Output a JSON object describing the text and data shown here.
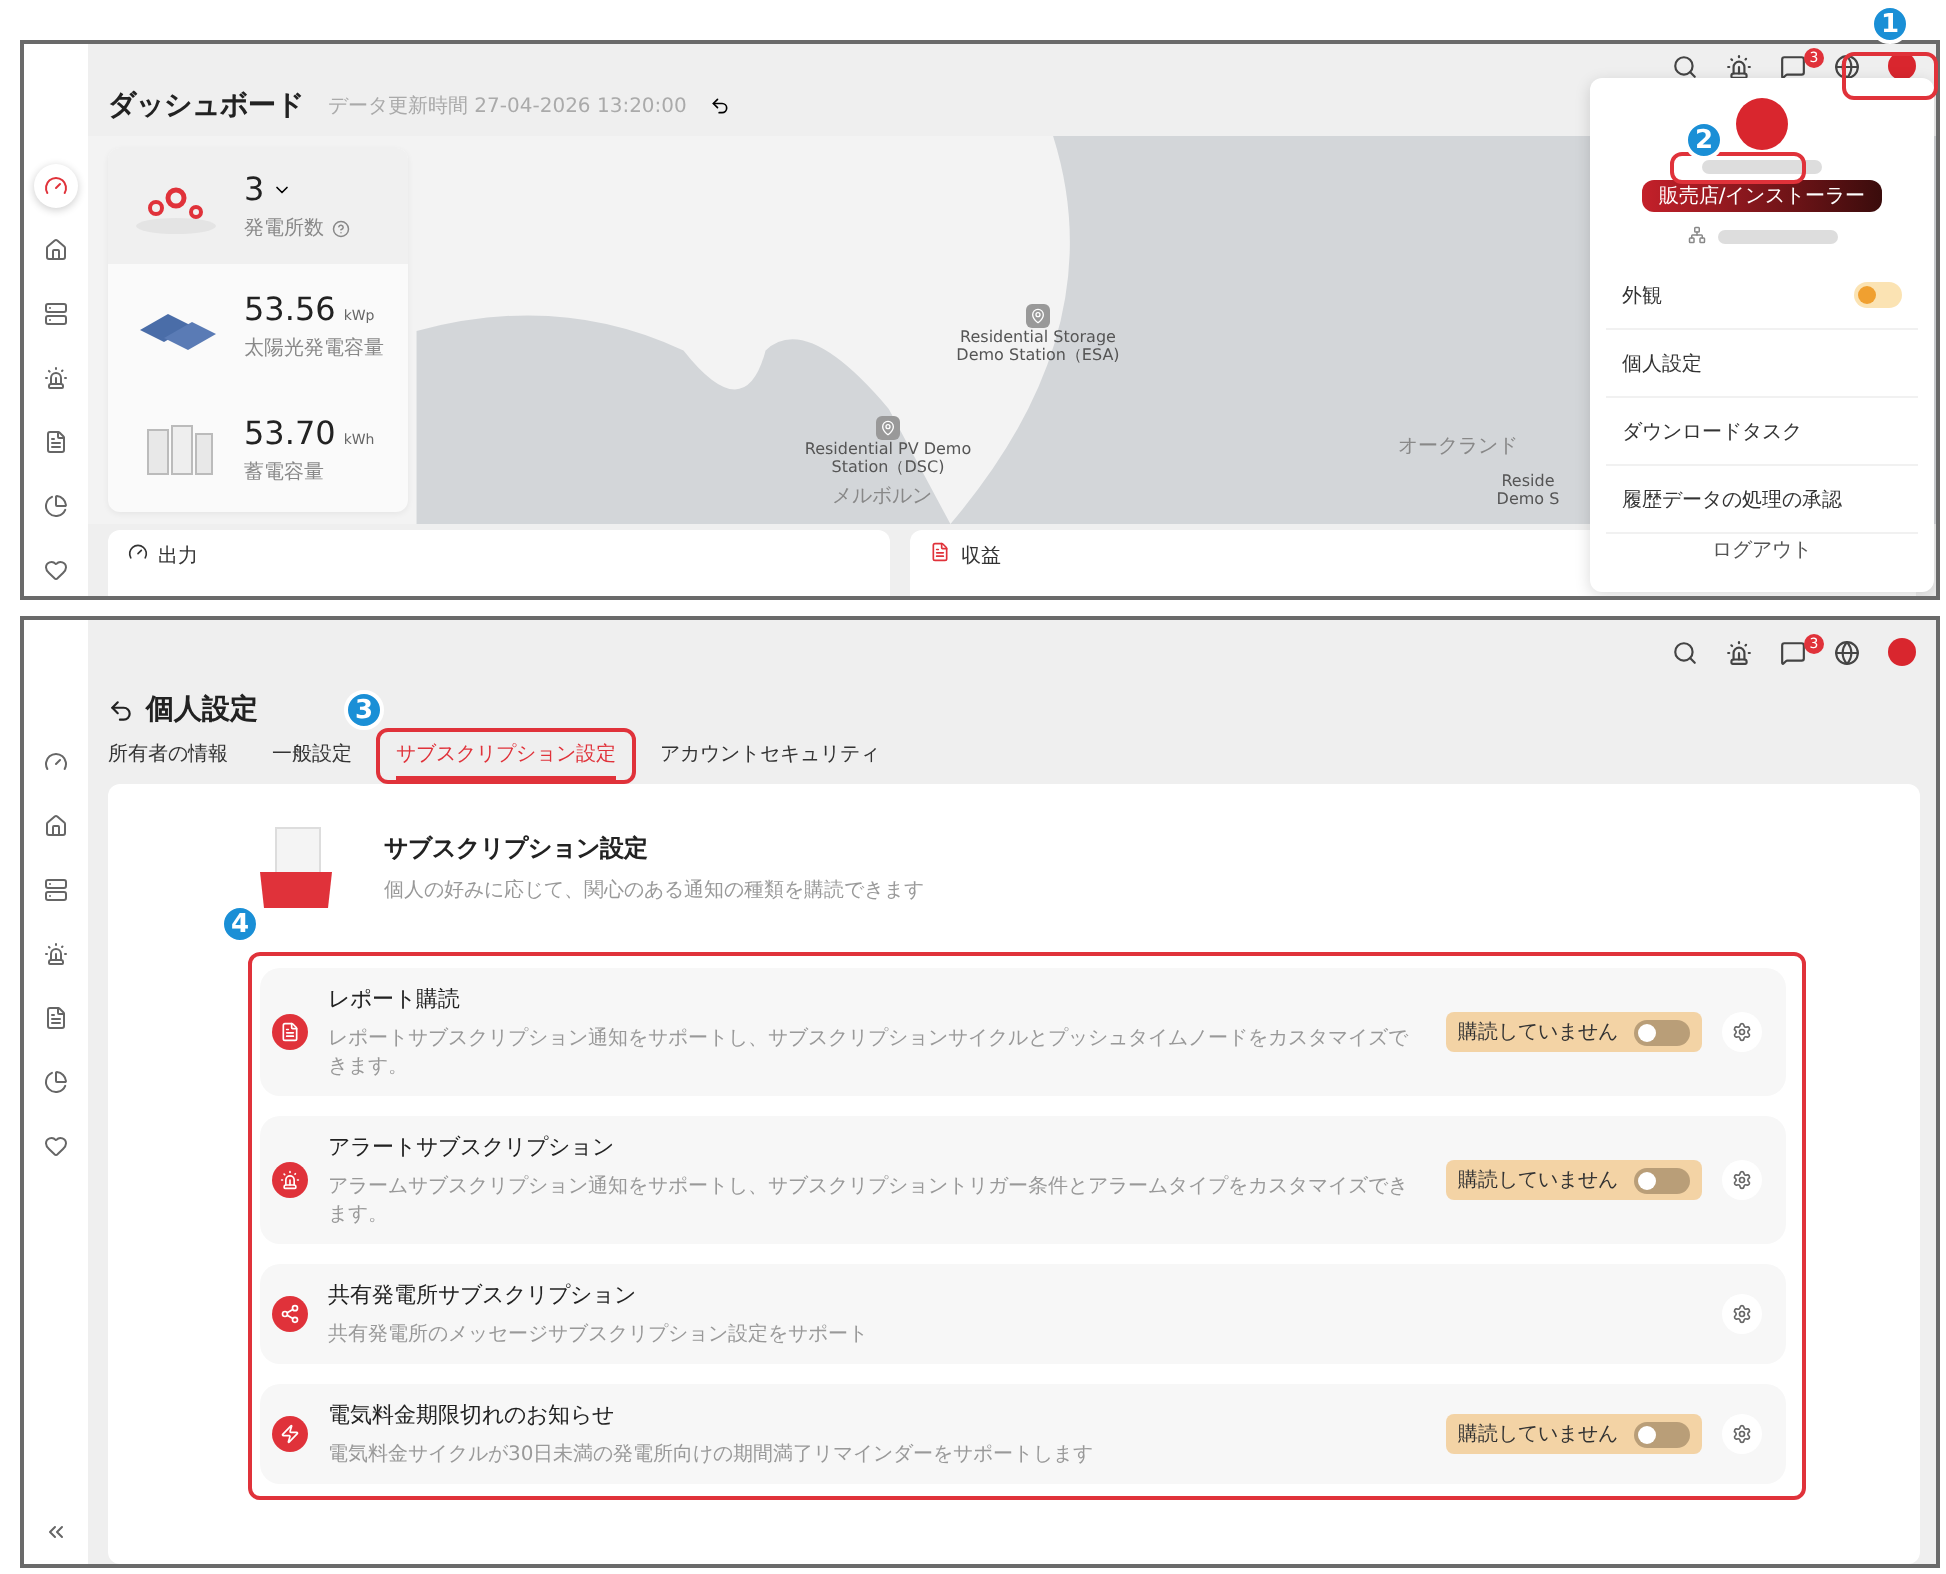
{
  "top_screen": {
    "sidebar_items": [
      {
        "selected": true
      },
      {
        "selected": false
      },
      {
        "selected": false
      },
      {
        "selected": false
      },
      {
        "selected": false
      },
      {
        "selected": false
      },
      {
        "selected": false
      }
    ],
    "message_badge": "3",
    "title": "ダッシュボード",
    "updated": "データ更新時間 27-04-2026 13:20:00",
    "stats": [
      {
        "kind": "count",
        "value": "3",
        "label": "発電所数"
      },
      {
        "kind": "solar",
        "value": "53.56",
        "unit": "kWp",
        "label": "太陽光発電容量"
      },
      {
        "kind": "storage",
        "value": "53.70",
        "unit": "kWh",
        "label": "蓄電容量"
      }
    ],
    "map_labels": [
      {
        "kind": "station",
        "text": "Residential Storage Demo Station（ESA)"
      },
      {
        "kind": "station",
        "text": "Residential PV Demo Station（DSC)"
      },
      {
        "kind": "city",
        "text": "メルボルン"
      },
      {
        "kind": "city",
        "text": "オークランド"
      },
      {
        "kind": "station",
        "text": "Reside Demo S"
      }
    ],
    "cards": [
      "出力",
      "収益"
    ],
    "user_menu": {
      "role": "販売店/インストーラー",
      "items": [
        {
          "kind": "toggle",
          "label": "外観",
          "on": false
        },
        {
          "kind": "link",
          "label": "個人設定"
        },
        {
          "kind": "link",
          "label": "ダウンロードタスク"
        },
        {
          "kind": "link",
          "label": "履歴データの処理の承認"
        }
      ],
      "logout": "ログアウト"
    }
  },
  "bottom_screen": {
    "message_badge": "3",
    "title": "個人設定",
    "tabs": [
      {
        "label": "所有者の情報",
        "selected": false
      },
      {
        "label": "一般設定",
        "selected": false
      },
      {
        "label": "サブスクリプション設定",
        "selected": true
      },
      {
        "label": "アカウントセキュリティ",
        "selected": false
      }
    ],
    "heading": "サブスクリプション設定",
    "subheading": "個人の好みに応じて、関心のある通知の種類を購読できます",
    "subscriptions": [
      {
        "kind": "report",
        "title": "レポート購読",
        "description": "レポートサブスクリプション通知をサポートし、サブスクリプションサイクルとプッシュタイムノードをカスタマイズできます。",
        "status": "購読していません",
        "on": false
      },
      {
        "kind": "alert",
        "title": "アラートサブスクリプション",
        "description": "アラームサブスクリプション通知をサポートし、サブスクリプショントリガー条件とアラームタイプをカスタマイズできます。",
        "status": "購読していません",
        "on": false
      },
      {
        "kind": "share",
        "title": "共有発電所サブスクリプション",
        "description": "共有発電所のメッセージサブスクリプション設定をサポート"
      },
      {
        "kind": "power",
        "title": "電気料金期限切れのお知らせ",
        "description": "電気料金サイクルが30日未満の発電所向けの期間満了リマインダーをサポートします",
        "status": "購読していません",
        "on": false
      }
    ]
  },
  "callouts": [
    "1",
    "2",
    "3",
    "4"
  ]
}
